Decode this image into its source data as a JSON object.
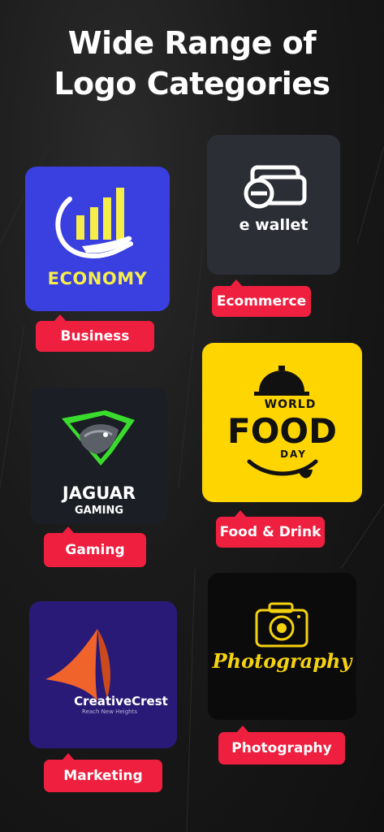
{
  "page": {
    "title_line1": "Wide Range of",
    "title_line2": "Logo Categories"
  },
  "categories": [
    {
      "tag": "Business",
      "logo_text": "ECONOMY",
      "logo_icon": "bar-chart-hand-icon"
    },
    {
      "tag": "Ecommerce",
      "logo_text": "e wallet",
      "logo_icon": "wallet-icon"
    },
    {
      "tag": "Gaming",
      "logo_text_1": "JAGUAR",
      "logo_text_2": "GAMING",
      "logo_icon": "jaguar-head-icon"
    },
    {
      "tag": "Food & Drink",
      "logo_text_1": "WORLD",
      "logo_text_2": "FOOD",
      "logo_text_3": "DAY",
      "logo_icon": "cloche-icon"
    },
    {
      "tag": "Marketing",
      "logo_text_1": "CreativeCrest",
      "logo_text_2": "Reach New Heights",
      "logo_icon": "arrow-a-icon"
    },
    {
      "tag": "Photography",
      "logo_text": "Photography",
      "logo_icon": "camera-icon"
    }
  ],
  "colors": {
    "accent_red": "#ef1f3f",
    "economy_blue": "#3a3fe0",
    "economy_yellow": "#f5ee4a",
    "food_yellow": "#ffd500",
    "marketing_navy": "#2a1a78",
    "marketing_orange": "#f0632a",
    "photo_gold": "#f5d20f"
  }
}
